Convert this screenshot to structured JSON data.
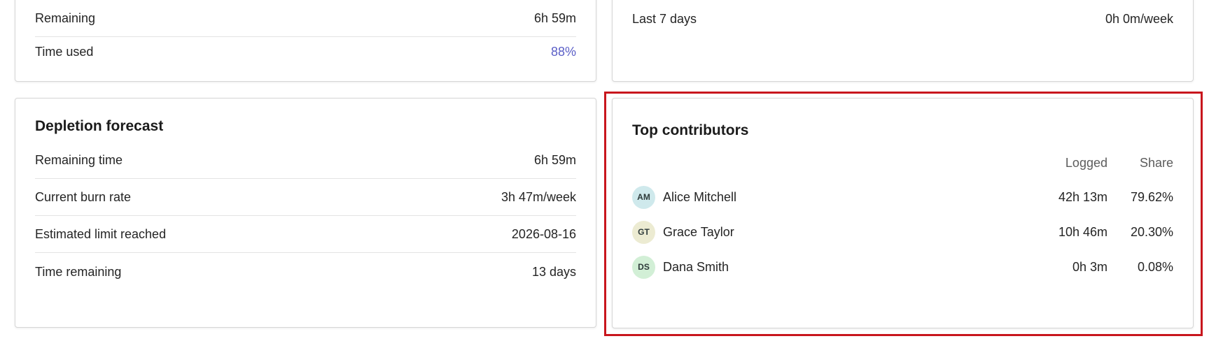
{
  "budget_card": {
    "rows": [
      {
        "label": "Remaining",
        "value": "6h 59m"
      },
      {
        "label": "Time used",
        "value": "88%"
      }
    ]
  },
  "activity_card": {
    "rows": [
      {
        "label": "Last 7 days",
        "value": "0h 0m/week"
      }
    ]
  },
  "forecast_card": {
    "title": "Depletion forecast",
    "rows": [
      {
        "label": "Remaining time",
        "value": "6h 59m"
      },
      {
        "label": "Current burn rate",
        "value": "3h 47m/week"
      },
      {
        "label": "Estimated limit reached",
        "value": "2026-08-16"
      },
      {
        "label": "Time remaining",
        "value": "13 days"
      }
    ]
  },
  "contributors_card": {
    "title": "Top contributors",
    "columns": {
      "logged": "Logged",
      "share": "Share"
    },
    "contributors": [
      {
        "initials": "AM",
        "name": "Alice Mitchell",
        "logged": "42h 13m",
        "share": "79.62%",
        "avatar_color": "#cfe9ec"
      },
      {
        "initials": "GT",
        "name": "Grace Taylor",
        "logged": "10h 46m",
        "share": "20.30%",
        "avatar_color": "#ecebd2"
      },
      {
        "initials": "DS",
        "name": "Dana Smith",
        "logged": "0h 3m",
        "share": "0.08%",
        "avatar_color": "#d2efd6"
      }
    ]
  },
  "colors": {
    "accent": "#5b5fc7",
    "highlight": "#c8161d"
  }
}
